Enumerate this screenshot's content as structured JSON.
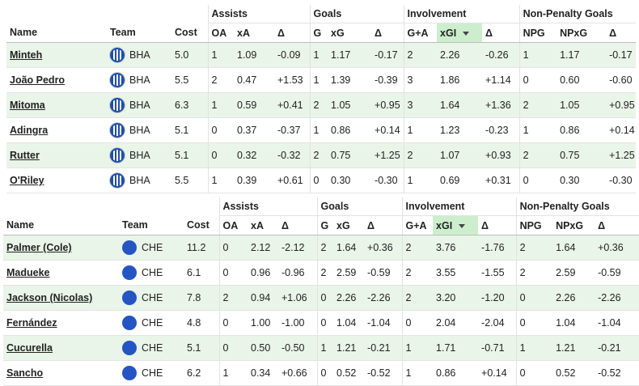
{
  "group_headers": {
    "assists": "Assists",
    "goals": "Goals",
    "involvement": "Involvement",
    "non_penalty_goals": "Non-Penalty Goals"
  },
  "column_headers": {
    "name": "Name",
    "team": "Team",
    "cost": "Cost",
    "oa": "OA",
    "xa": "xA",
    "delta": "Δ",
    "g": "G",
    "xg": "xG",
    "ga": "G+A",
    "xgi": "xGI",
    "npg": "NPG",
    "npxg": "NPxG"
  },
  "sorted_column": "xGI",
  "colors": {
    "row_alt": "#e9f5e8",
    "sorted_header": "#cdeecd",
    "bha_badge": "#1f4fa8",
    "che_badge": "#2455c3"
  },
  "tables": [
    {
      "team": "BHA",
      "badge_icon": "brighton-badge-icon",
      "rows": [
        {
          "name": "Minteh",
          "team": "BHA",
          "cost": "5.0",
          "oa": "1",
          "xa": "1.09",
          "da": "-0.09",
          "g": "1",
          "xg": "1.17",
          "dg": "-0.17",
          "ga": "2",
          "xgi": "2.26",
          "dgi": "-0.26",
          "npg": "1",
          "npxg": "1.17",
          "dnp": "-0.17"
        },
        {
          "name": "João Pedro",
          "team": "BHA",
          "cost": "5.5",
          "oa": "2",
          "xa": "0.47",
          "da": "+1.53",
          "g": "1",
          "xg": "1.39",
          "dg": "-0.39",
          "ga": "3",
          "xgi": "1.86",
          "dgi": "+1.14",
          "npg": "0",
          "npxg": "0.60",
          "dnp": "-0.60"
        },
        {
          "name": "Mitoma",
          "team": "BHA",
          "cost": "6.3",
          "oa": "1",
          "xa": "0.59",
          "da": "+0.41",
          "g": "2",
          "xg": "1.05",
          "dg": "+0.95",
          "ga": "3",
          "xgi": "1.64",
          "dgi": "+1.36",
          "npg": "2",
          "npxg": "1.05",
          "dnp": "+0.95"
        },
        {
          "name": "Adingra",
          "team": "BHA",
          "cost": "5.1",
          "oa": "0",
          "xa": "0.37",
          "da": "-0.37",
          "g": "1",
          "xg": "0.86",
          "dg": "+0.14",
          "ga": "1",
          "xgi": "1.23",
          "dgi": "-0.23",
          "npg": "1",
          "npxg": "0.86",
          "dnp": "+0.14"
        },
        {
          "name": "Rutter",
          "team": "BHA",
          "cost": "5.1",
          "oa": "0",
          "xa": "0.32",
          "da": "-0.32",
          "g": "2",
          "xg": "0.75",
          "dg": "+1.25",
          "ga": "2",
          "xgi": "1.07",
          "dgi": "+0.93",
          "npg": "2",
          "npxg": "0.75",
          "dnp": "+1.25"
        },
        {
          "name": "O'Riley",
          "team": "BHA",
          "cost": "5.5",
          "oa": "1",
          "xa": "0.39",
          "da": "+0.61",
          "g": "0",
          "xg": "0.30",
          "dg": "-0.30",
          "ga": "1",
          "xgi": "0.69",
          "dgi": "+0.31",
          "npg": "0",
          "npxg": "0.30",
          "dnp": "-0.30"
        }
      ]
    },
    {
      "team": "CHE",
      "badge_icon": "chelsea-badge-icon",
      "rows": [
        {
          "name": "Palmer (Cole)",
          "team": "CHE",
          "cost": "11.2",
          "oa": "0",
          "xa": "2.12",
          "da": "-2.12",
          "g": "2",
          "xg": "1.64",
          "dg": "+0.36",
          "ga": "2",
          "xgi": "3.76",
          "dgi": "-1.76",
          "npg": "2",
          "npxg": "1.64",
          "dnp": "+0.36"
        },
        {
          "name": "Madueke",
          "team": "CHE",
          "cost": "6.1",
          "oa": "0",
          "xa": "0.96",
          "da": "-0.96",
          "g": "2",
          "xg": "2.59",
          "dg": "-0.59",
          "ga": "2",
          "xgi": "3.55",
          "dgi": "-1.55",
          "npg": "2",
          "npxg": "2.59",
          "dnp": "-0.59"
        },
        {
          "name": "Jackson (Nicolas)",
          "team": "CHE",
          "cost": "7.8",
          "oa": "2",
          "xa": "0.94",
          "da": "+1.06",
          "g": "0",
          "xg": "2.26",
          "dg": "-2.26",
          "ga": "2",
          "xgi": "3.20",
          "dgi": "-1.20",
          "npg": "0",
          "npxg": "2.26",
          "dnp": "-2.26"
        },
        {
          "name": "Fernández",
          "team": "CHE",
          "cost": "4.8",
          "oa": "0",
          "xa": "1.00",
          "da": "-1.00",
          "g": "0",
          "xg": "1.04",
          "dg": "-1.04",
          "ga": "0",
          "xgi": "2.04",
          "dgi": "-2.04",
          "npg": "0",
          "npxg": "1.04",
          "dnp": "-1.04"
        },
        {
          "name": "Cucurella",
          "team": "CHE",
          "cost": "5.1",
          "oa": "0",
          "xa": "0.50",
          "da": "-0.50",
          "g": "1",
          "xg": "1.21",
          "dg": "-0.21",
          "ga": "1",
          "xgi": "1.71",
          "dgi": "-0.71",
          "npg": "1",
          "npxg": "1.21",
          "dnp": "-0.21"
        },
        {
          "name": "Sancho",
          "team": "CHE",
          "cost": "6.2",
          "oa": "1",
          "xa": "0.34",
          "da": "+0.66",
          "g": "0",
          "xg": "0.52",
          "dg": "-0.52",
          "ga": "1",
          "xgi": "0.86",
          "dgi": "+0.14",
          "npg": "0",
          "npxg": "0.52",
          "dnp": "-0.52"
        }
      ]
    }
  ]
}
